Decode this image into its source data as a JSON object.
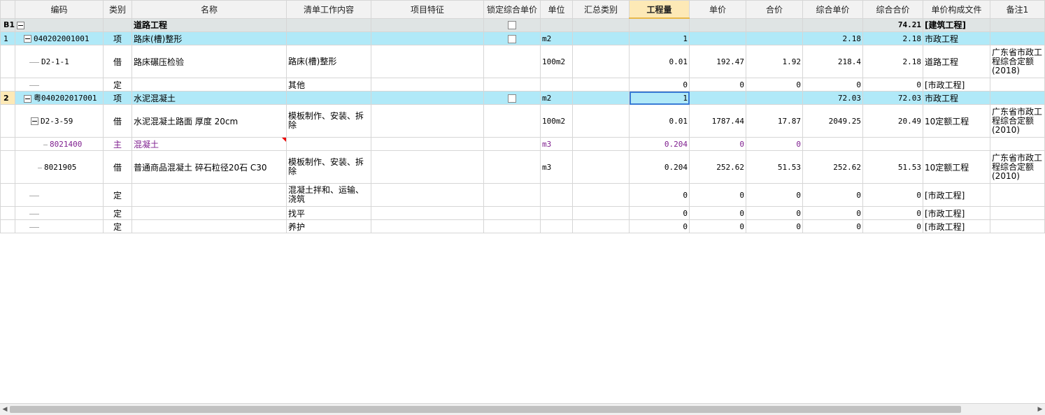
{
  "headers": [
    "",
    "编码",
    "类别",
    "名称",
    "清单工作内容",
    "项目特征",
    "锁定综合单价",
    "单位",
    "汇总类别",
    "工程量",
    "单价",
    "合价",
    "综合单价",
    "综合合价",
    "单价构成文件",
    "备注1"
  ],
  "rows": [
    {
      "rownum": "B1",
      "code": "",
      "type": "",
      "name": "道路工程",
      "work": "",
      "feature": "",
      "unit": "",
      "summary": "",
      "qty": "",
      "price": "",
      "total": "",
      "cprice": "",
      "ctotal": "74.21",
      "file": "[建筑工程]",
      "note": ""
    },
    {
      "rownum": "1",
      "code": "040202001001",
      "type": "项",
      "name": "路床(槽)整形",
      "work": "",
      "feature": "",
      "unit": "m2",
      "summary": "",
      "qty": "1",
      "price": "",
      "total": "",
      "cprice": "2.18",
      "ctotal": "2.18",
      "file": "市政工程",
      "note": ""
    },
    {
      "rownum": "",
      "code": "D2-1-1",
      "type": "借",
      "name": "路床碾压检验",
      "work": "路床(槽)整形",
      "feature": "",
      "unit": "100m2",
      "summary": "",
      "qty": "0.01",
      "price": "192.47",
      "total": "1.92",
      "cprice": "218.4",
      "ctotal": "2.18",
      "file": "道路工程",
      "note": "广东省市政工程综合定额(2018)"
    },
    {
      "rownum": "",
      "code": "",
      "type": "定",
      "name": "",
      "work": "其他",
      "feature": "",
      "unit": "",
      "summary": "",
      "qty": "0",
      "price": "0",
      "total": "0",
      "cprice": "0",
      "ctotal": "0",
      "file": "[市政工程]",
      "note": ""
    },
    {
      "rownum": "2",
      "code": "粤040202017001",
      "type": "项",
      "name": "水泥混凝土",
      "work": "",
      "feature": "",
      "unit": "m2",
      "summary": "",
      "qty": "1",
      "price": "",
      "total": "",
      "cprice": "72.03",
      "ctotal": "72.03",
      "file": "市政工程",
      "note": ""
    },
    {
      "rownum": "",
      "code": "D2-3-59",
      "type": "借",
      "name": "水泥混凝土路面 厚度 20cm",
      "work": "模板制作、安装、拆除",
      "feature": "",
      "unit": "100m2",
      "summary": "",
      "qty": "0.01",
      "price": "1787.44",
      "total": "17.87",
      "cprice": "2049.25",
      "ctotal": "20.49",
      "file": "10定额工程",
      "note": "广东省市政工程综合定额(2010)"
    },
    {
      "rownum": "",
      "code": "8021400",
      "type": "主",
      "name": "混凝土",
      "work": "",
      "feature": "",
      "unit": "m3",
      "summary": "",
      "qty": "0.204",
      "price": "0",
      "total": "0",
      "cprice": "",
      "ctotal": "",
      "file": "",
      "note": ""
    },
    {
      "rownum": "",
      "code": "8021905",
      "type": "借",
      "name": "普通商品混凝土 碎石粒径20石 C30",
      "work": "模板制作、安装、拆除",
      "feature": "",
      "unit": "m3",
      "summary": "",
      "qty": "0.204",
      "price": "252.62",
      "total": "51.53",
      "cprice": "252.62",
      "ctotal": "51.53",
      "file": "10定额工程",
      "note": "广东省市政工程综合定额(2010)"
    },
    {
      "rownum": "",
      "code": "",
      "type": "定",
      "name": "",
      "work": "混凝土拌和、运输、浇筑",
      "feature": "",
      "unit": "",
      "summary": "",
      "qty": "0",
      "price": "0",
      "total": "0",
      "cprice": "0",
      "ctotal": "0",
      "file": "[市政工程]",
      "note": ""
    },
    {
      "rownum": "",
      "code": "",
      "type": "定",
      "name": "",
      "work": "找平",
      "feature": "",
      "unit": "",
      "summary": "",
      "qty": "0",
      "price": "0",
      "total": "0",
      "cprice": "0",
      "ctotal": "0",
      "file": "[市政工程]",
      "note": ""
    },
    {
      "rownum": "",
      "code": "",
      "type": "定",
      "name": "",
      "work": "养护",
      "feature": "",
      "unit": "",
      "summary": "",
      "qty": "0",
      "price": "0",
      "total": "0",
      "cprice": "0",
      "ctotal": "0",
      "file": "[市政工程]",
      "note": ""
    }
  ],
  "colors": {
    "group_row": "#dfe4e4",
    "selected_row": "#b0e9f8",
    "active_header": "#fde9b6",
    "material_text": "#7f1f8f"
  },
  "icons": {
    "expand": "collapse-minus-icon",
    "checkbox": "lock-checkbox-icon",
    "scroll_left": "arrow-left-icon",
    "scroll_right": "arrow-right-icon"
  }
}
